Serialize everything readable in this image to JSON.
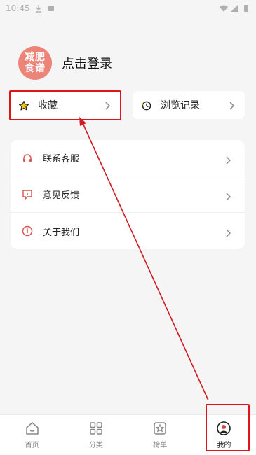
{
  "status_bar": {
    "time": "10:45"
  },
  "profile": {
    "avatar_text_line1": "减肥",
    "avatar_text_line2": "食谱",
    "login_label": "点击登录"
  },
  "quick": {
    "favorites_label": "收藏",
    "history_label": "浏览记录"
  },
  "menu": {
    "items": [
      {
        "label": "联系客服",
        "icon": "headset-icon"
      },
      {
        "label": "意见反馈",
        "icon": "feedback-icon"
      },
      {
        "label": "关于我们",
        "icon": "info-icon"
      }
    ]
  },
  "tabs": [
    {
      "label": "首页",
      "icon": "home-icon"
    },
    {
      "label": "分类",
      "icon": "grid-icon"
    },
    {
      "label": "榜单",
      "icon": "ranking-icon"
    },
    {
      "label": "我的",
      "icon": "user-icon",
      "active": true
    }
  ],
  "colors": {
    "accent": "#e0141c",
    "avatar": "#ec8577",
    "menu_icon": "#d9534f",
    "background": "#f5f5f5"
  }
}
